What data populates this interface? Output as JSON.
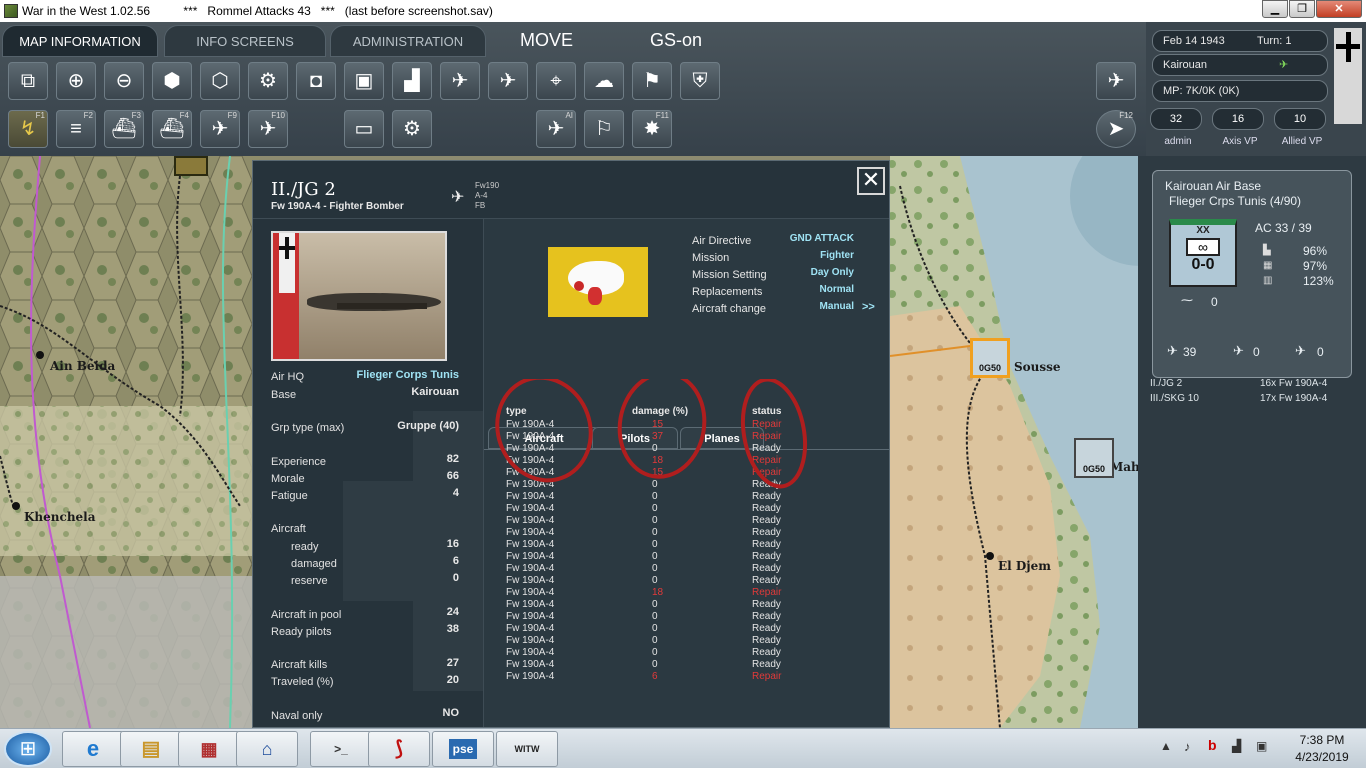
{
  "window": {
    "title": "War in the West 1.02.56          ***   Rommel Attacks 43   ***   (last before screenshot.sav)"
  },
  "tabs": [
    {
      "label": "MAP INFORMATION"
    },
    {
      "label": "INFO SCREENS"
    },
    {
      "label": "ADMINISTRATION"
    }
  ],
  "mode": {
    "move": "MOVE",
    "gs": "GS-on"
  },
  "toolbar_fkeys": {
    "f1": "F1",
    "f2": "F2",
    "f3": "F3",
    "f4": "F4",
    "f9": "F9",
    "f10": "F10",
    "f11": "F11",
    "f12": "F12",
    "ai": "AI"
  },
  "status": {
    "date": "Feb 14 1943",
    "turn": "Turn: 1",
    "location": "Kairouan",
    "mp": "MP:  7K/0K (0K)",
    "admin_value": "32",
    "admin_label": "admin",
    "axis_vp": "16",
    "axis_vp_label": "Axis VP",
    "allied_vp": "10",
    "allied_vp_label": "Allied VP"
  },
  "map_labels": {
    "ain_beida": "Ain Beida",
    "khenchela": "Khenchela",
    "sousse": "Sousse",
    "mahdia": "Mahdi",
    "el_djem": "El Djem",
    "counter1": "0G50",
    "counter2": "0G50"
  },
  "hex_info": {
    "title": "Kairouan Air Base",
    "subtitle": "Flieger Crps Tunis  (4/90)",
    "ac": "AC  33 / 39",
    "unit_size": "XX",
    "unit_strength": "0-0",
    "pct1": "96%",
    "pct2": "97%",
    "pct3": "123%",
    "support": "0",
    "fighters": "39",
    "bombers": "0",
    "recon": "0",
    "groups": [
      {
        "name": "II./JG 2",
        "aircraft": "16x Fw 190A-4"
      },
      {
        "name": "III./SKG 10",
        "aircraft": "17x Fw 190A-4"
      }
    ]
  },
  "dialog": {
    "unit_name": "II./JG 2",
    "unit_type": "Fw 190A-4  -  Fighter Bomber",
    "icon_caption": "Fw190\nA-4\nFB",
    "left_fields": [
      {
        "label": "Air HQ",
        "value": "Flieger Corps Tunis",
        "cyan": true
      },
      {
        "label": "Base",
        "value": "Kairouan"
      },
      {
        "label": "Grp type (max)",
        "value": "Gruppe (40)"
      },
      {
        "label": "Experience",
        "value": "82"
      },
      {
        "label": "Morale",
        "value": "66"
      },
      {
        "label": "Fatigue",
        "value": "4"
      },
      {
        "label": "Aircraft",
        "value": ""
      },
      {
        "label": "ready",
        "value": "16"
      },
      {
        "label": "damaged",
        "value": "6"
      },
      {
        "label": "reserve",
        "value": "0"
      },
      {
        "label": "Aircraft in pool",
        "value": "24"
      },
      {
        "label": "Ready pilots",
        "value": "38"
      },
      {
        "label": "Aircraft kills",
        "value": "27"
      },
      {
        "label": "Traveled (%)",
        "value": "20"
      },
      {
        "label": "Naval only",
        "value": "NO"
      }
    ],
    "settings": [
      {
        "label": "Air Directive",
        "value": "GND ATTACK"
      },
      {
        "label": "Mission",
        "value": "Fighter"
      },
      {
        "label": "Mission Setting",
        "value": "Day Only"
      },
      {
        "label": "Replacements",
        "value": "Normal"
      },
      {
        "label": "Aircraft change",
        "value": "Manual"
      }
    ],
    "more": ">>",
    "subtabs": [
      "Aircraft",
      "Pilots",
      "Planes"
    ],
    "columns": {
      "type": "type",
      "damage": "damage (%)",
      "status": "status"
    },
    "aircraft": [
      {
        "type": "Fw 190A-4",
        "damage": "15",
        "status": "Repair"
      },
      {
        "type": "Fw 190A-4",
        "damage": "37",
        "status": "Repair"
      },
      {
        "type": "Fw 190A-4",
        "damage": "0",
        "status": "Ready"
      },
      {
        "type": "Fw 190A-4",
        "damage": "18",
        "status": "Repair"
      },
      {
        "type": "Fw 190A-4",
        "damage": "15",
        "status": "Repair"
      },
      {
        "type": "Fw 190A-4",
        "damage": "0",
        "status": "Ready"
      },
      {
        "type": "Fw 190A-4",
        "damage": "0",
        "status": "Ready"
      },
      {
        "type": "Fw 190A-4",
        "damage": "0",
        "status": "Ready"
      },
      {
        "type": "Fw 190A-4",
        "damage": "0",
        "status": "Ready"
      },
      {
        "type": "Fw 190A-4",
        "damage": "0",
        "status": "Ready"
      },
      {
        "type": "Fw 190A-4",
        "damage": "0",
        "status": "Ready"
      },
      {
        "type": "Fw 190A-4",
        "damage": "0",
        "status": "Ready"
      },
      {
        "type": "Fw 190A-4",
        "damage": "0",
        "status": "Ready"
      },
      {
        "type": "Fw 190A-4",
        "damage": "0",
        "status": "Ready"
      },
      {
        "type": "Fw 190A-4",
        "damage": "18",
        "status": "Repair"
      },
      {
        "type": "Fw 190A-4",
        "damage": "0",
        "status": "Ready"
      },
      {
        "type": "Fw 190A-4",
        "damage": "0",
        "status": "Ready"
      },
      {
        "type": "Fw 190A-4",
        "damage": "0",
        "status": "Ready"
      },
      {
        "type": "Fw 190A-4",
        "damage": "0",
        "status": "Ready"
      },
      {
        "type": "Fw 190A-4",
        "damage": "0",
        "status": "Ready"
      },
      {
        "type": "Fw 190A-4",
        "damage": "0",
        "status": "Ready"
      },
      {
        "type": "Fw 190A-4",
        "damage": "6",
        "status": "Repair"
      }
    ]
  },
  "taskbar": {
    "pse_label": "pse",
    "witw_label": "WITW",
    "time": "7:38 PM",
    "date": "4/23/2019"
  },
  "colors": {
    "damaged": "#e23a3a",
    "highlight": "#9fe3f4",
    "annotation": "#b01e1e"
  }
}
